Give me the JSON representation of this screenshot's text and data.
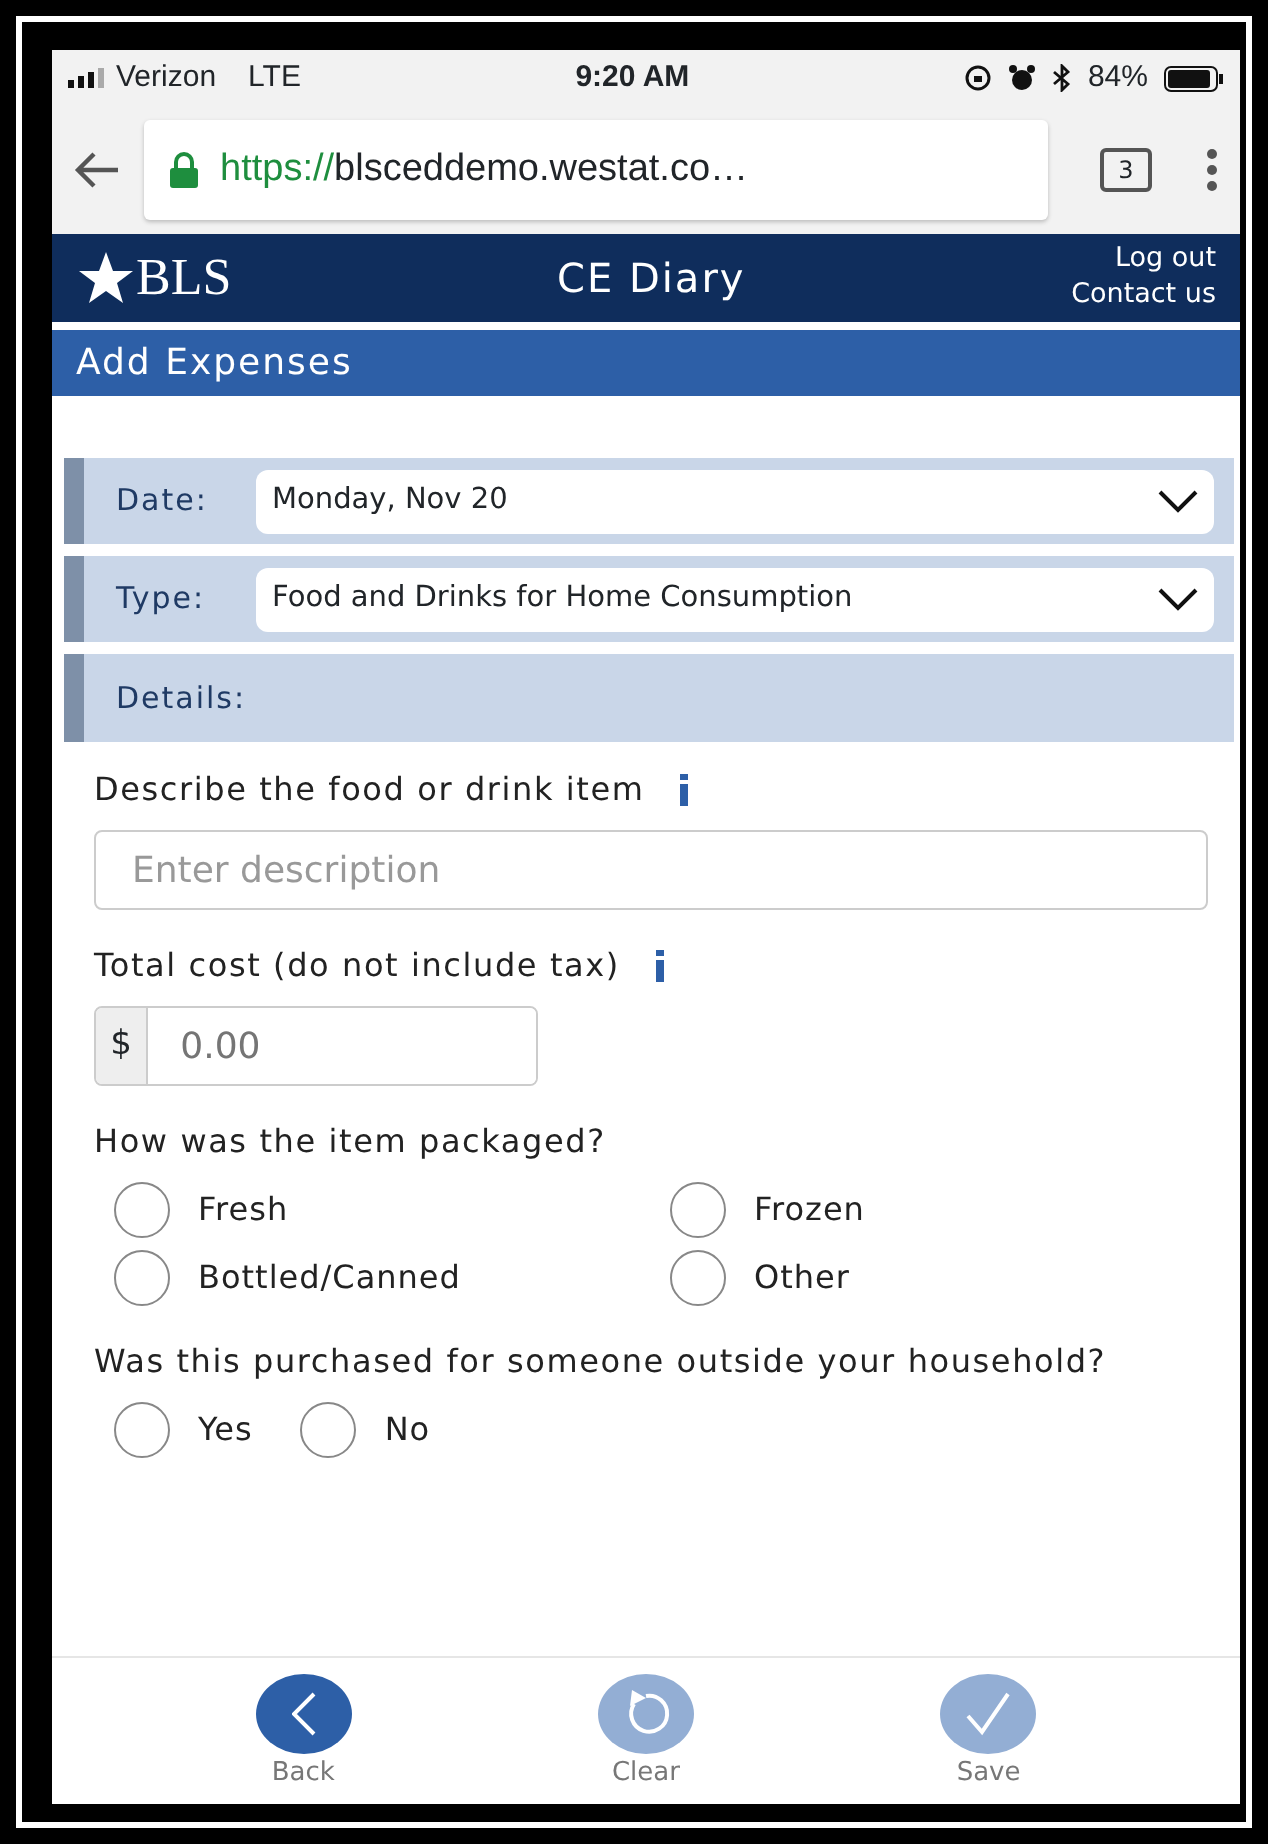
{
  "status_bar": {
    "carrier": "Verizon",
    "network": "LTE",
    "time": "9:20 AM",
    "battery": "84%"
  },
  "browser": {
    "url_scheme": "https://",
    "url_rest": "blsceddemo.westat.co…",
    "tab_count": "3"
  },
  "header": {
    "logo": "BLS",
    "title": "CE Diary",
    "links": [
      "Log out",
      "Contact us"
    ]
  },
  "page_title": "Add Expenses",
  "selects": [
    {
      "label": "Date:",
      "value": "Monday, Nov 20"
    },
    {
      "label": "Type:",
      "value": "Food and Drinks for Home Consumption"
    }
  ],
  "details_label": "Details:",
  "description": {
    "label": "Describe the food or drink item",
    "placeholder": "Enter description"
  },
  "cost": {
    "label": "Total cost (do not include tax)",
    "prefix": "$",
    "placeholder": "0.00"
  },
  "questions": [
    {
      "text": "How was the item packaged?",
      "kind": "grid",
      "options": [
        {
          "label": "Fresh",
          "selected": false
        },
        {
          "label": "Frozen",
          "selected": false
        },
        {
          "label": "Bottled/Canned",
          "selected": false
        },
        {
          "label": "Other",
          "selected": false
        }
      ]
    },
    {
      "text": "Was this purchased for someone outside your household?",
      "kind": "inline",
      "options": [
        {
          "label": "Yes",
          "selected": false
        },
        {
          "label": "No",
          "selected": false
        }
      ]
    }
  ],
  "footer_buttons": [
    {
      "kind": "back",
      "label": "Back",
      "disabled": false
    },
    {
      "kind": "clear",
      "label": "Clear",
      "disabled": true
    },
    {
      "kind": "save",
      "label": "Save",
      "disabled": true
    }
  ]
}
